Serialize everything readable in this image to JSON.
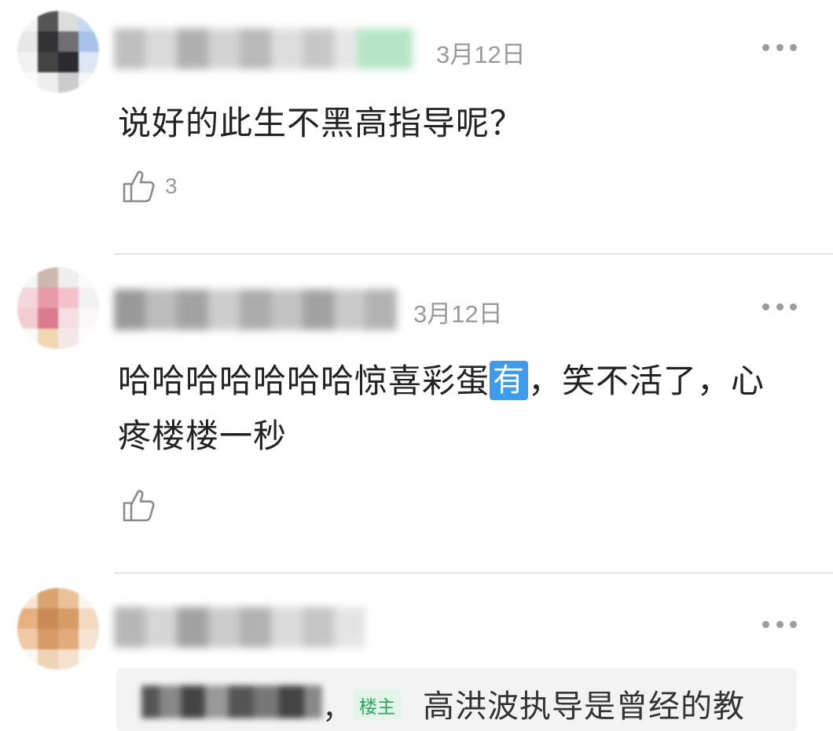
{
  "comments": [
    {
      "date": "3月12日",
      "text": "说好的此生不黑高指导呢？",
      "likes": "3",
      "more_label": "more-options"
    },
    {
      "date": "3月12日",
      "text_before": "哈哈哈哈哈哈哈惊喜彩蛋",
      "tag": "有",
      "text_after": "，笑不活了，心疼楼楼一秒",
      "likes": "",
      "more_label": "more-options"
    },
    {
      "date": "",
      "quote": {
        "op_badge": "楼主",
        "text": "高洪波执导是曾经的教",
        "comma": "，"
      },
      "more_label": "more-options"
    }
  ],
  "colors": {
    "accent_green": "#26a65b",
    "inline_tag_blue": "#3d9be9",
    "meta_gray": "#9a9a9a"
  },
  "icons": [
    "thumbs-up-icon",
    "more-dots-icon"
  ]
}
